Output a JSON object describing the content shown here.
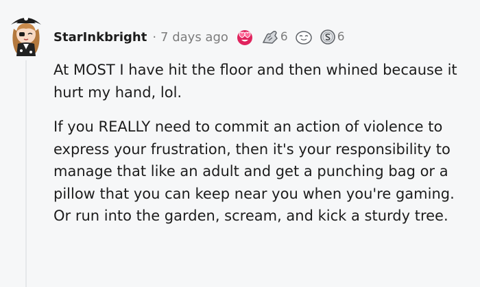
{
  "comment": {
    "author": "StarInkbright",
    "separator": "·",
    "timestamp": "7 days ago",
    "awards": [
      {
        "icon": "heart-eyes-award-icon",
        "count": ""
      },
      {
        "icon": "helpful-hands-award-icon",
        "count": "6"
      },
      {
        "icon": "wholesome-face-award-icon",
        "count": ""
      },
      {
        "icon": "silver-award-icon",
        "count": "6"
      }
    ],
    "paragraphs": [
      "At MOST I have hit the floor and then whined because it hurt my hand, lol.",
      "If you REALLY need to commit an action of violence to express your frustration, then it's your responsibility to manage that like an adult and get a punching bag or a pillow that you can keep near you when you're gaming. Or run into the garden, scream, and kick a sturdy tree."
    ]
  },
  "colors": {
    "background": "#f6f7f8",
    "text": "#1c1c1c",
    "meta": "#7c7c7c",
    "award_red": "#e0245e"
  }
}
